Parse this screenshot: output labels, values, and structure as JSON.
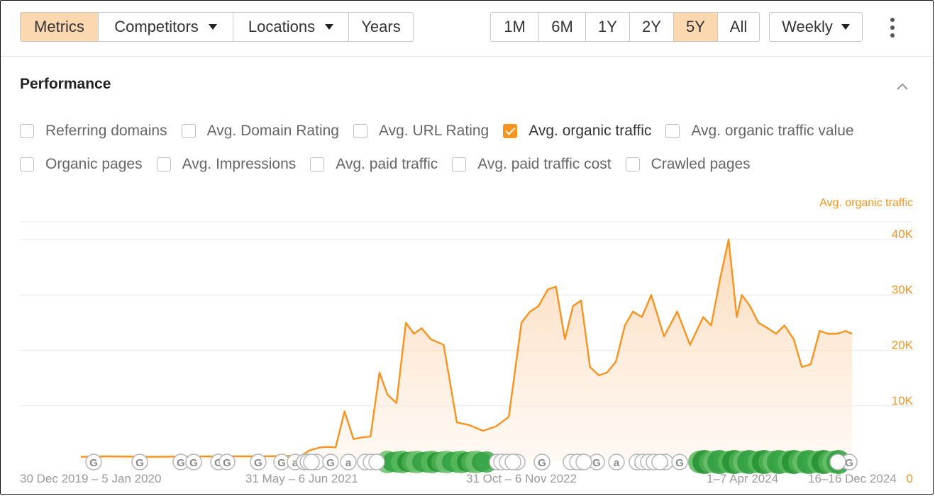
{
  "toolbar": {
    "left_group": [
      {
        "label": "Metrics",
        "active": true,
        "caret": false
      },
      {
        "label": "Competitors",
        "active": false,
        "caret": true
      },
      {
        "label": "Locations",
        "active": false,
        "caret": true
      },
      {
        "label": "Years",
        "active": false,
        "caret": false
      }
    ],
    "ranges": [
      {
        "label": "1M",
        "active": false
      },
      {
        "label": "6M",
        "active": false
      },
      {
        "label": "1Y",
        "active": false
      },
      {
        "label": "2Y",
        "active": false
      },
      {
        "label": "5Y",
        "active": true
      },
      {
        "label": "All",
        "active": false
      }
    ],
    "interval": "Weekly",
    "more_icon": "kebab-vertical-icon"
  },
  "panel": {
    "title": "Performance",
    "collapse_icon": "chevron-up-icon",
    "checkboxes_row1": [
      {
        "label": "Referring domains",
        "checked": false
      },
      {
        "label": "Avg. Domain Rating",
        "checked": false
      },
      {
        "label": "Avg. URL Rating",
        "checked": false
      },
      {
        "label": "Avg. organic traffic",
        "checked": true
      },
      {
        "label": "Avg. organic traffic value",
        "checked": false
      }
    ],
    "checkboxes_row2": [
      {
        "label": "Organic pages",
        "checked": false
      },
      {
        "label": "Avg. Impressions",
        "checked": false
      },
      {
        "label": "Avg. paid traffic",
        "checked": false
      },
      {
        "label": "Avg. paid traffic cost",
        "checked": false
      },
      {
        "label": "Crawled pages",
        "checked": false
      }
    ]
  },
  "colors": {
    "accent": "#f7931e",
    "active_bg": "#fcd8b1",
    "marker_green": "#2e9e3e",
    "grid": "#ececec"
  },
  "chart_data": {
    "type": "area",
    "series": [
      {
        "name": "Avg. organic traffic",
        "x": [
          "2019-12-30",
          "2020-03-01",
          "2020-06-01",
          "2020-09-01",
          "2020-12-01",
          "2021-03-01",
          "2021-05-31",
          "2021-06-20",
          "2021-07-15",
          "2021-08-01",
          "2021-08-20",
          "2021-09-10",
          "2021-10-01",
          "2021-10-20",
          "2021-11-10",
          "2021-12-01",
          "2021-12-20",
          "2022-01-10",
          "2022-02-01",
          "2022-02-20",
          "2022-03-10",
          "2022-04-01",
          "2022-05-01",
          "2022-06-01",
          "2022-07-01",
          "2022-08-01",
          "2022-09-01",
          "2022-10-01",
          "2022-10-31",
          "2022-11-20",
          "2022-12-10",
          "2023-01-01",
          "2023-01-20",
          "2023-02-10",
          "2023-03-01",
          "2023-03-20",
          "2023-04-10",
          "2023-05-01",
          "2023-05-20",
          "2023-06-10",
          "2023-07-01",
          "2023-07-20",
          "2023-08-10",
          "2023-09-01",
          "2023-10-01",
          "2023-11-01",
          "2023-12-01",
          "2024-01-01",
          "2024-01-20",
          "2024-02-10",
          "2024-03-01",
          "2024-03-20",
          "2024-04-01",
          "2024-04-20",
          "2024-05-10",
          "2024-06-01",
          "2024-06-20",
          "2024-07-10",
          "2024-08-01",
          "2024-08-20",
          "2024-09-10",
          "2024-10-01",
          "2024-10-20",
          "2024-11-10",
          "2024-12-01",
          "2024-12-16"
        ],
        "values": [
          800,
          900,
          800,
          850,
          900,
          900,
          1000,
          2000,
          2500,
          2600,
          2500,
          9000,
          4000,
          4300,
          4500,
          16000,
          12000,
          10500,
          25000,
          23000,
          24000,
          22000,
          21000,
          7000,
          6500,
          5500,
          6300,
          8000,
          25000,
          27000,
          28000,
          31000,
          31500,
          22000,
          28000,
          29000,
          17000,
          15500,
          16000,
          18000,
          24500,
          27000,
          26000,
          30000,
          22500,
          27000,
          21000,
          26000,
          24500,
          33000,
          40000,
          26000,
          30000,
          28000,
          25000,
          24000,
          23000,
          24500,
          22000,
          17000,
          17500,
          23500,
          23000,
          23000,
          23500,
          23000
        ]
      }
    ],
    "y_axis_label": "Avg. organic traffic",
    "y_ticks": [
      "0",
      "10K",
      "20K",
      "30K",
      "40K"
    ],
    "ylim": [
      0,
      40000
    ],
    "x_tick_labels": [
      "30 Dec 2019 – 5 Jan 2020",
      "31 May – 6 Jun 2021",
      "31 Oct – 6 Nov 2022",
      "1–7 Apr 2024",
      "16–16 Dec 2024"
    ],
    "grid": true,
    "annotation_markers": {
      "gray_letters": [
        "G",
        "G",
        "G",
        "G",
        "G",
        "G",
        "G",
        "G",
        "a",
        "2",
        "G",
        "a",
        "G",
        "G",
        "G",
        "G",
        "G",
        "a",
        "a",
        "2",
        "G",
        "G"
      ],
      "green_dense_periods": [
        "2021-07 to 2022-04",
        "2023-09 to 2024-11"
      ]
    }
  }
}
